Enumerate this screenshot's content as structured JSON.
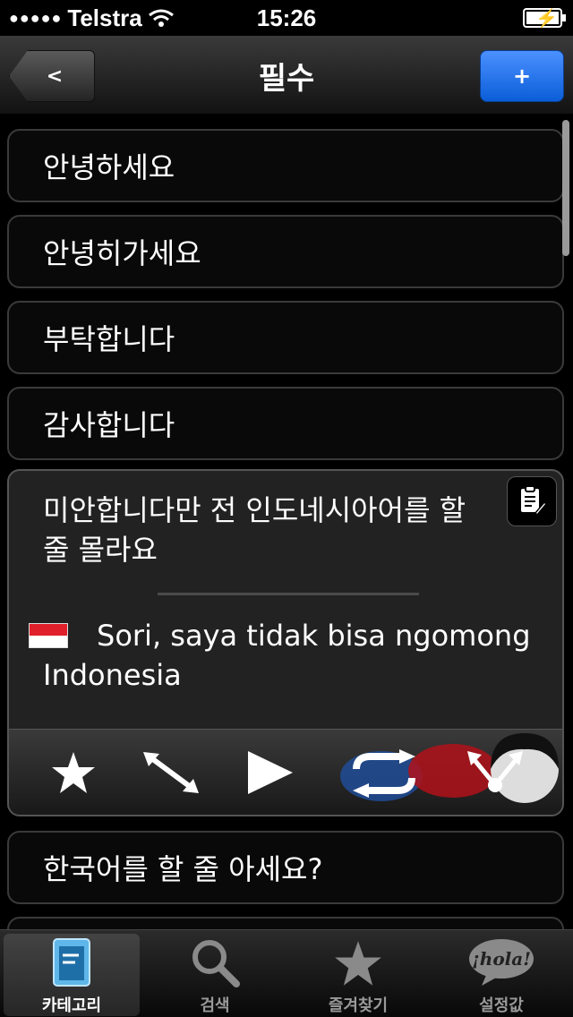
{
  "status_bar": {
    "carrier": "Telstra",
    "time": "15:26",
    "signal_dots": "●●●●●"
  },
  "nav": {
    "title": "필수",
    "back_label": "<",
    "add_label": "+"
  },
  "phrases": [
    {
      "text": "안녕하세요"
    },
    {
      "text": "안녕히가세요"
    },
    {
      "text": "부탁합니다"
    },
    {
      "text": "감사합니다"
    }
  ],
  "expanded": {
    "korean": "미안합니다만 전 인도네시아어를 할 줄 몰라요",
    "translation": "Sori, saya tidak bisa ngomong Indonesia",
    "flag_icon": "indonesia-flag-icon",
    "actions": [
      "star-icon",
      "expand-arrows-icon",
      "play-icon",
      "repeat-icon",
      "share-icon"
    ]
  },
  "next_phrase": {
    "text": "한국어를 할 줄 아세요?"
  },
  "tabs": [
    {
      "label": "카테고리",
      "icon": "book-icon",
      "active": true
    },
    {
      "label": "검색",
      "icon": "search-icon",
      "active": false
    },
    {
      "label": "즐겨찾기",
      "icon": "star-icon",
      "active": false
    },
    {
      "label": "설정값",
      "icon": "hola-bubble-icon",
      "active": false,
      "icon_text": "¡hola!"
    }
  ],
  "colors": {
    "accent_blue": "#0b5ed8",
    "flag_red": "#e0202a"
  }
}
